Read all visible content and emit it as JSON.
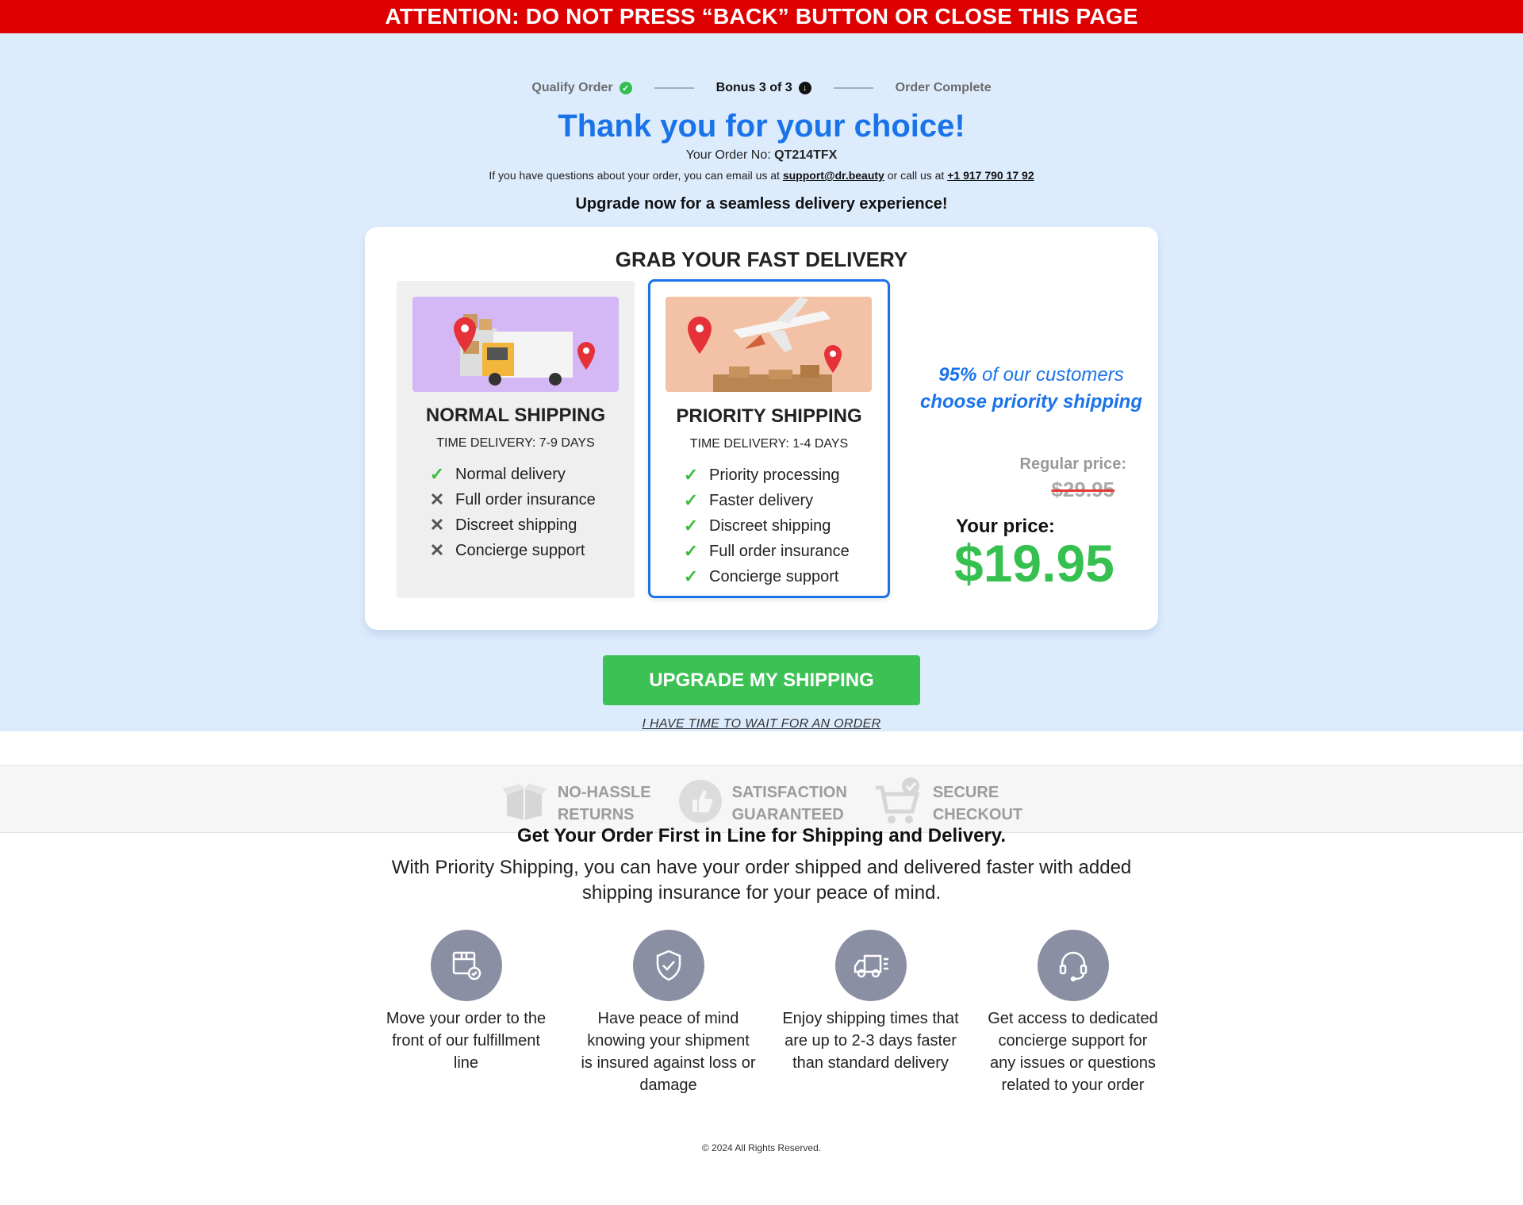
{
  "banner": "ATTENTION: DO NOT PRESS “BACK” BUTTON OR CLOSE THIS PAGE",
  "steps": [
    {
      "label": "Qualify Order",
      "icon": "check-circle-icon"
    },
    {
      "label": "Bonus 3 of 3",
      "icon": "arrow-down-circle-icon"
    },
    {
      "label": "Order Complete",
      "icon": ""
    }
  ],
  "header": {
    "title": "Thank you for your choice!",
    "order_prefix": "Your Order No: ",
    "order_no": "QT214TFX",
    "contact_prefix": "If you have questions about your order, you can email us at ",
    "email": "support@dr.beauty",
    "contact_mid": " or call us at ",
    "phone": "+1 917 790 17 92",
    "subhead": "Upgrade now for a seamless delivery experience!"
  },
  "card": {
    "title": "GRAB YOUR FAST DELIVERY",
    "normal": {
      "name": "NORMAL SHIPPING",
      "time": "TIME DELIVERY: 7-9 DAYS",
      "features": [
        "Normal delivery",
        "Full order insurance",
        "Discreet shipping",
        "Concierge support"
      ]
    },
    "priority": {
      "name": "PRIORITY SHIPPING",
      "time": "TIME DELIVERY: 1-4 DAYS",
      "features": [
        "Priority processing",
        "Faster delivery",
        "Discreet shipping",
        "Full order insurance",
        "Concierge support"
      ]
    },
    "stat_pct": "95%",
    "stat_rest": " of our customers",
    "stat_line2": "choose priority shipping",
    "regular_label": "Regular price:",
    "regular_price": "$29.95",
    "your_label": "Your price:",
    "your_price": "$19.95"
  },
  "cta": {
    "upgrade": "UPGRADE MY SHIPPING",
    "decline": "I HAVE TIME TO WAIT FOR AN ORDER"
  },
  "trust": [
    {
      "line1": "NO-HASSLE",
      "line2": "RETURNS",
      "icon": "open-box-icon"
    },
    {
      "line1": "SATISFACTION",
      "line2": "GUARANTEED",
      "icon": "thumbs-up-icon"
    },
    {
      "line1": "SECURE",
      "line2": "CHECKOUT",
      "icon": "cart-check-icon"
    }
  ],
  "info": {
    "heading": "Get Your Order First in Line for Shipping and Delivery.",
    "desc": "With Priority Shipping, you can have your order shipped and delivered faster with added shipping insurance for your peace of mind."
  },
  "benefits": [
    {
      "text": "Move your order to the front of our fulfillment line",
      "icon": "package-check-icon"
    },
    {
      "text": "Have peace of mind knowing your shipment is insured against loss or damage",
      "icon": "shield-check-icon"
    },
    {
      "text": "Enjoy shipping times that are up to 2-3 days faster than standard delivery",
      "icon": "fast-truck-icon"
    },
    {
      "text": "Get access to dedicated concierge support for any issues or questions related to your order",
      "icon": "headset-icon"
    }
  ],
  "footer": "© 2024 All Rights Reserved.",
  "colors": {
    "banner": "#dd0000",
    "accent": "#1a73e8",
    "green": "#3cc154",
    "top_bg": "#ddecfd"
  }
}
